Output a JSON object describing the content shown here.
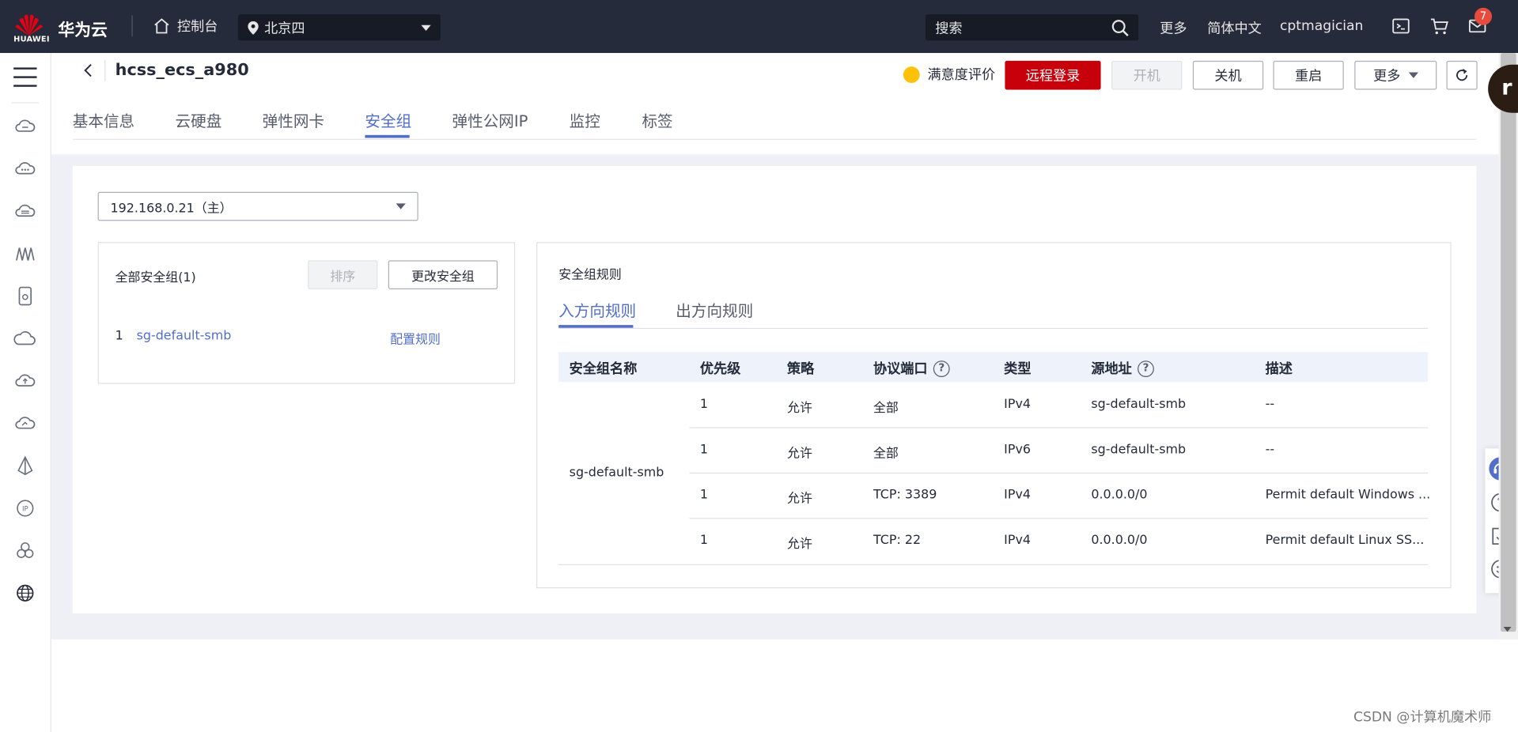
{
  "topbar": {
    "logo_text": "HUAWEI",
    "brand": "华为云",
    "console": "控制台",
    "region": "北京四",
    "search_placeholder": "搜索",
    "more": "更多",
    "language": "简体中文",
    "username": "cptmagician",
    "notification_count": "7"
  },
  "header": {
    "title": "hcss_ecs_a980",
    "satisfaction": "满意度评价",
    "buttons": {
      "remote_login": "远程登录",
      "power_on": "开机",
      "power_off": "关机",
      "restart": "重启",
      "more": "更多"
    },
    "tabs": [
      "基本信息",
      "云硬盘",
      "弹性网卡",
      "安全组",
      "弹性公网IP",
      "监控",
      "标签"
    ],
    "active_tab": "安全组"
  },
  "nic_select": "192.168.0.21（主）",
  "security_groups": {
    "title": "全部安全组(1)",
    "sort_button": "排序",
    "change_button": "更改安全组",
    "items": [
      {
        "index": "1",
        "name": "sg-default-smb",
        "action": "配置规则"
      }
    ]
  },
  "rules": {
    "title": "安全组规则",
    "tabs": [
      "入方向规则",
      "出方向规则"
    ],
    "active_tab": "入方向规则",
    "columns": [
      "安全组名称",
      "优先级",
      "策略",
      "协议端口",
      "类型",
      "源地址",
      "描述"
    ],
    "group_name": "sg-default-smb",
    "rows": [
      {
        "priority": "1",
        "policy": "允许",
        "port": "全部",
        "type": "IPv4",
        "source": "sg-default-smb",
        "desc": "--"
      },
      {
        "priority": "1",
        "policy": "允许",
        "port": "全部",
        "type": "IPv6",
        "source": "sg-default-smb",
        "desc": "--"
      },
      {
        "priority": "1",
        "policy": "允许",
        "port": "TCP: 3389",
        "type": "IPv4",
        "source": "0.0.0.0/0",
        "desc": "Permit default Windows ..."
      },
      {
        "priority": "1",
        "policy": "允许",
        "port": "TCP: 22",
        "type": "IPv4",
        "source": "0.0.0.0/0",
        "desc": "Permit default Linux SS..."
      }
    ]
  },
  "avatar_letter": "r",
  "watermark": "CSDN @计算机魔术师",
  "colors": {
    "topbar": "#252b3a",
    "primary_red": "#c7000b",
    "link_blue": "#526ecc",
    "page_bg": "#eef0f5"
  }
}
